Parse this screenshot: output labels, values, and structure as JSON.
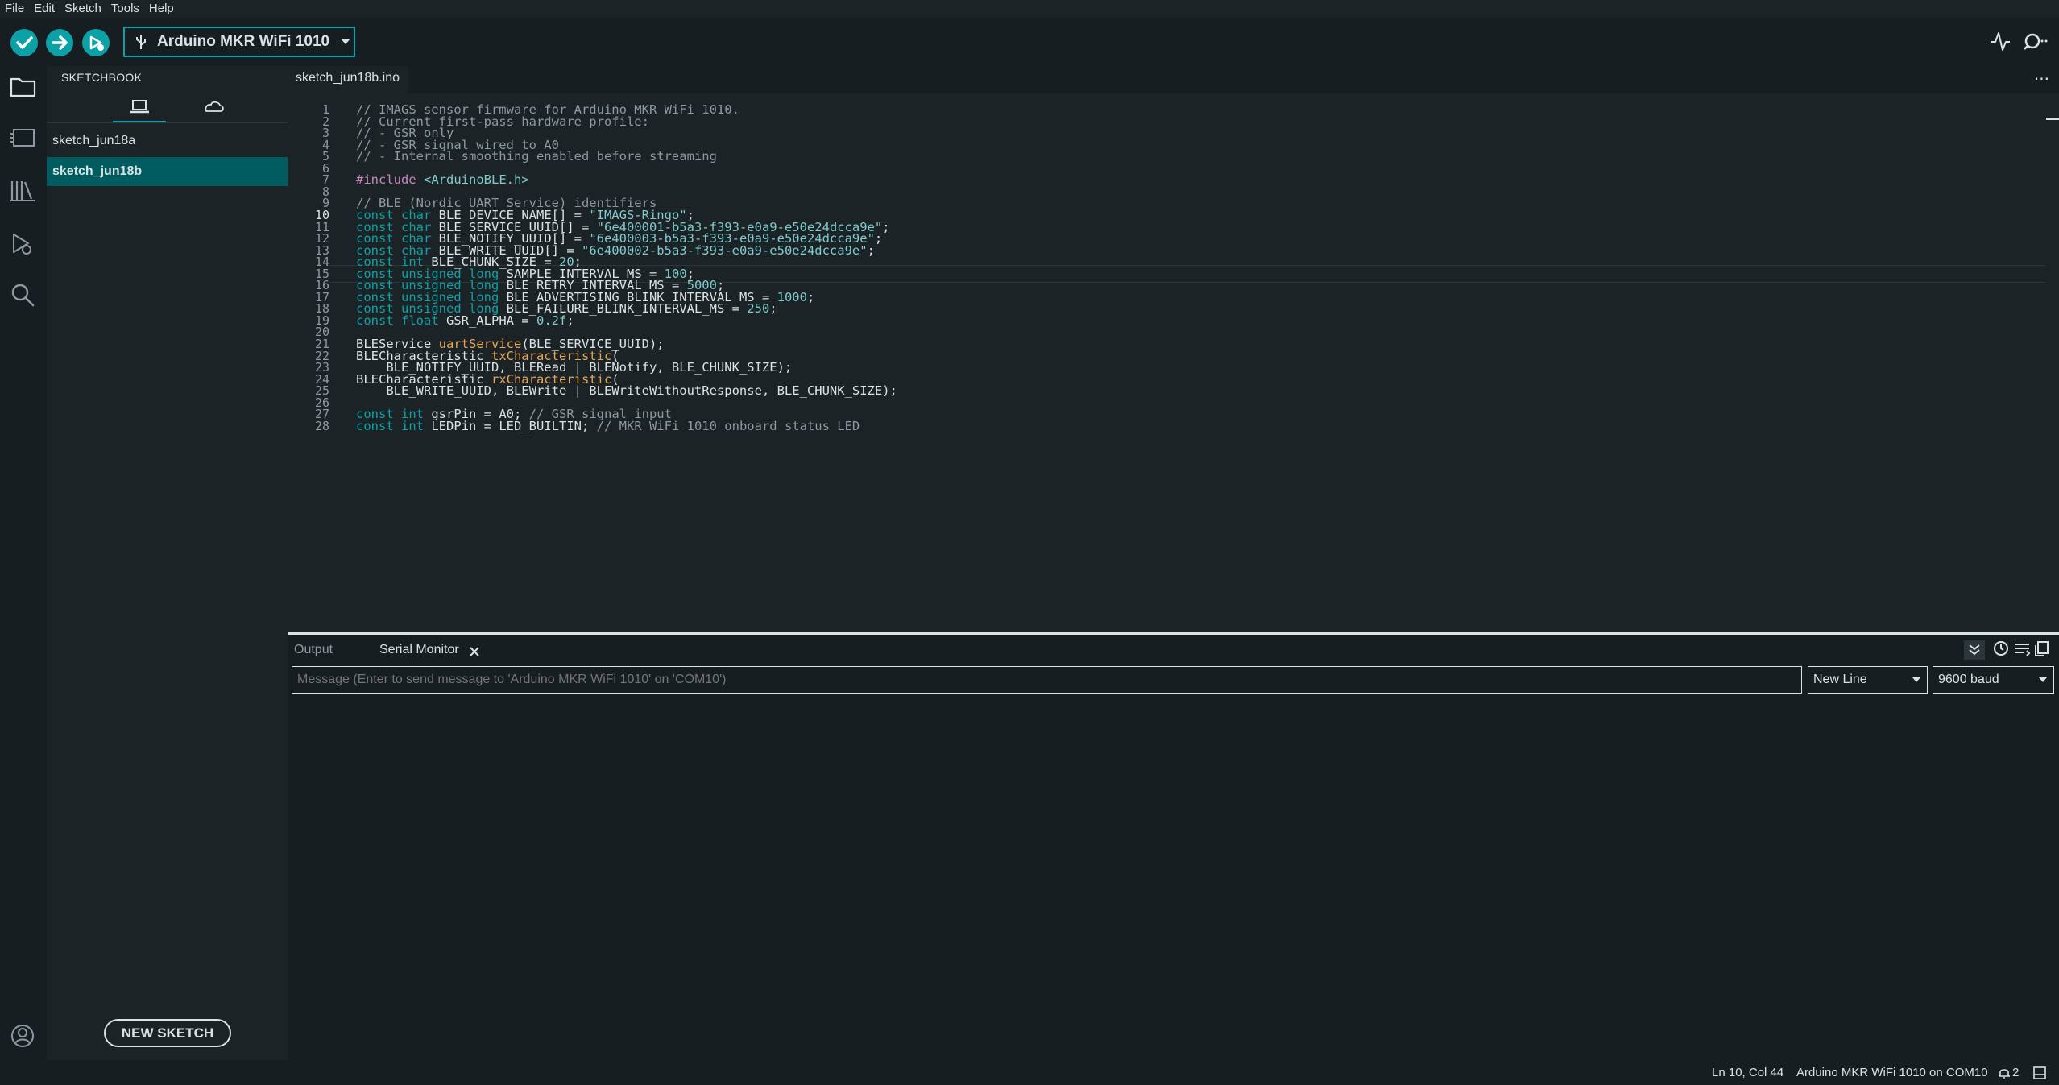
{
  "menubar": {
    "items": [
      "File",
      "Edit",
      "Sketch",
      "Tools",
      "Help"
    ]
  },
  "toolbar": {
    "verify_icon": "check-icon",
    "upload_icon": "arrow-right-icon",
    "debug_icon": "debug-icon",
    "board_label": "Arduino MKR WiFi 1010",
    "serial_plotter_icon": "pulse-icon",
    "serial_monitor_icon": "magnifier-icon"
  },
  "sidebar": {
    "title": "SKETCHBOOK",
    "tabs": [
      "local-sketchbook-icon",
      "cloud-icon"
    ],
    "sketches": [
      "sketch_jun18a",
      "sketch_jun18b"
    ],
    "selected": "sketch_jun18b",
    "new_sketch_label": "NEW SKETCH"
  },
  "editor": {
    "tab_label": "sketch_jun18b.ino",
    "more_label": "···",
    "active_line": 10,
    "line_numbers": [
      "1",
      "2",
      "3",
      "4",
      "5",
      "6",
      "7",
      "8",
      "9",
      "10",
      "11",
      "12",
      "13",
      "14",
      "15",
      "16",
      "17",
      "18",
      "19",
      "20",
      "21",
      "22",
      "23",
      "24",
      "25",
      "26",
      "27",
      "28"
    ],
    "lines": [
      [
        [
          "c",
          "// IMAGS sensor firmware for Arduino MKR WiFi 1010."
        ]
      ],
      [
        [
          "c",
          "// Current first-pass hardware profile:"
        ]
      ],
      [
        [
          "c",
          "// - GSR only"
        ]
      ],
      [
        [
          "c",
          "// - GSR signal wired to A0"
        ]
      ],
      [
        [
          "c",
          "// - Internal smoothing enabled before streaming"
        ]
      ],
      [],
      [
        [
          "p",
          "#include "
        ],
        [
          "inc",
          "<ArduinoBLE.h>"
        ]
      ],
      [],
      [
        [
          "c",
          "// BLE (Nordic UART Service) identifiers"
        ]
      ],
      [
        [
          "k",
          "const"
        ],
        [
          "t",
          " "
        ],
        [
          "k",
          "char"
        ],
        [
          "t",
          " BLE_DEVICE_NAME[] = "
        ],
        [
          "s",
          "\"IMAGS-Ringo\""
        ],
        [
          "t",
          ";"
        ]
      ],
      [
        [
          "k",
          "const"
        ],
        [
          "t",
          " "
        ],
        [
          "k",
          "char"
        ],
        [
          "t",
          " BLE_SERVICE_UUID[] = "
        ],
        [
          "s",
          "\"6e400001-b5a3-f393-e0a9-e50e24dcca9e\""
        ],
        [
          "t",
          ";"
        ]
      ],
      [
        [
          "k",
          "const"
        ],
        [
          "t",
          " "
        ],
        [
          "k",
          "char"
        ],
        [
          "t",
          " BLE_NOTIFY_UUID[] = "
        ],
        [
          "s",
          "\"6e400003-b5a3-f393-e0a9-e50e24dcca9e\""
        ],
        [
          "t",
          ";"
        ]
      ],
      [
        [
          "k",
          "const"
        ],
        [
          "t",
          " "
        ],
        [
          "k",
          "char"
        ],
        [
          "t",
          " BLE_WRITE_UUID[] = "
        ],
        [
          "s",
          "\"6e400002-b5a3-f393-e0a9-e50e24dcca9e\""
        ],
        [
          "t",
          ";"
        ]
      ],
      [
        [
          "k",
          "const"
        ],
        [
          "t",
          " "
        ],
        [
          "k",
          "int"
        ],
        [
          "t",
          " BLE_CHUNK_SIZE = "
        ],
        [
          "n",
          "20"
        ],
        [
          "t",
          ";"
        ]
      ],
      [
        [
          "k",
          "const"
        ],
        [
          "t",
          " "
        ],
        [
          "k",
          "unsigned"
        ],
        [
          "t",
          " "
        ],
        [
          "k",
          "long"
        ],
        [
          "t",
          " SAMPLE_INTERVAL_MS = "
        ],
        [
          "n",
          "100"
        ],
        [
          "t",
          ";"
        ]
      ],
      [
        [
          "k",
          "const"
        ],
        [
          "t",
          " "
        ],
        [
          "k",
          "unsigned"
        ],
        [
          "t",
          " "
        ],
        [
          "k",
          "long"
        ],
        [
          "t",
          " BLE_RETRY_INTERVAL_MS = "
        ],
        [
          "n",
          "5000"
        ],
        [
          "t",
          ";"
        ]
      ],
      [
        [
          "k",
          "const"
        ],
        [
          "t",
          " "
        ],
        [
          "k",
          "unsigned"
        ],
        [
          "t",
          " "
        ],
        [
          "k",
          "long"
        ],
        [
          "t",
          " BLE_ADVERTISING_BLINK_INTERVAL_MS = "
        ],
        [
          "n",
          "1000"
        ],
        [
          "t",
          ";"
        ]
      ],
      [
        [
          "k",
          "const"
        ],
        [
          "t",
          " "
        ],
        [
          "k",
          "unsigned"
        ],
        [
          "t",
          " "
        ],
        [
          "k",
          "long"
        ],
        [
          "t",
          " BLE_FAILURE_BLINK_INTERVAL_MS = "
        ],
        [
          "n",
          "250"
        ],
        [
          "t",
          ";"
        ]
      ],
      [
        [
          "k",
          "const"
        ],
        [
          "t",
          " "
        ],
        [
          "k",
          "float"
        ],
        [
          "t",
          " GSR_ALPHA = "
        ],
        [
          "n",
          "0.2f"
        ],
        [
          "t",
          ";"
        ]
      ],
      [],
      [
        [
          "t",
          "BLEService "
        ],
        [
          "f",
          "uartService"
        ],
        [
          "t",
          "(BLE_SERVICE_UUID);"
        ]
      ],
      [
        [
          "t",
          "BLECharacteristic "
        ],
        [
          "f",
          "txCharacteristic"
        ],
        [
          "t",
          "("
        ]
      ],
      [
        [
          "t",
          "    BLE_NOTIFY_UUID, BLERead | BLENotify, BLE_CHUNK_SIZE);"
        ]
      ],
      [
        [
          "t",
          "BLECharacteristic "
        ],
        [
          "f",
          "rxCharacteristic"
        ],
        [
          "t",
          "("
        ]
      ],
      [
        [
          "t",
          "    BLE_WRITE_UUID, BLEWrite | BLEWriteWithoutResponse, BLE_CHUNK_SIZE);"
        ]
      ],
      [],
      [
        [
          "k",
          "const"
        ],
        [
          "t",
          " "
        ],
        [
          "k",
          "int"
        ],
        [
          "t",
          " gsrPin = A0; "
        ],
        [
          "c",
          "// GSR signal input"
        ]
      ],
      [
        [
          "k",
          "const"
        ],
        [
          "t",
          " "
        ],
        [
          "k",
          "int"
        ],
        [
          "t",
          " LEDPin = LED_BUILTIN; "
        ],
        [
          "c",
          "// MKR WiFi 1010 onboard status LED"
        ]
      ]
    ]
  },
  "panel": {
    "tabs": {
      "output": "Output",
      "serial_monitor": "Serial Monitor"
    },
    "close_icon": "close-icon",
    "message_placeholder": "Message (Enter to send message to 'Arduino MKR WiFi 1010' on 'COM10')",
    "message_value": "",
    "line_ending": "New Line",
    "baud_rate": "9600 baud",
    "toolbar_icons": [
      "collapse-icon",
      "clock-icon",
      "list-icon",
      "copy-icon"
    ]
  },
  "statusbar": {
    "cursor": "Ln 10, Col 44",
    "board_port": "Arduino MKR WiFi 1010 on COM10",
    "notifications": "2",
    "notification_icon": "bell-icon",
    "layout_icon": "panel-icon"
  }
}
